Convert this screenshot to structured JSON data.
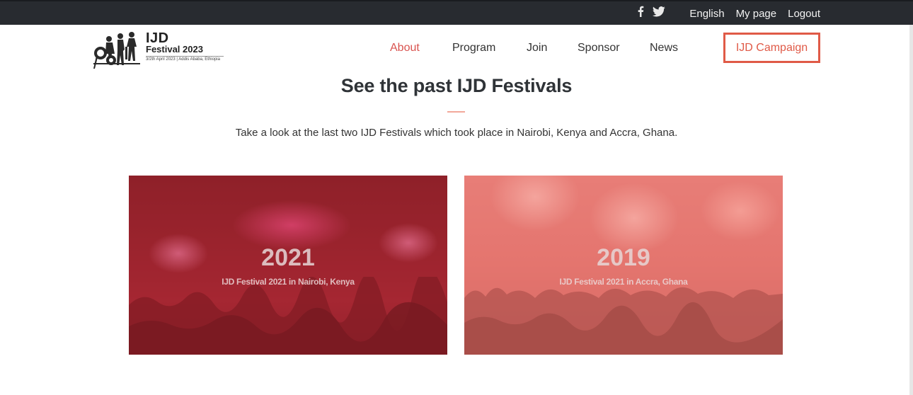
{
  "topbar": {
    "social": [
      {
        "icon": "facebook-icon",
        "glyph": "f"
      },
      {
        "icon": "twitter-icon"
      }
    ],
    "links": [
      "English",
      "My page",
      "Logout"
    ]
  },
  "logo": {
    "title": "IJD",
    "subtitle": "Festival 2023",
    "small": "3/2th April 2023 | Addis Ababa, Ethiopia"
  },
  "nav": {
    "items": [
      "About",
      "Program",
      "Join",
      "Sponsor",
      "News"
    ],
    "active": "About",
    "campaign": "IJD Campaign"
  },
  "section": {
    "title": "See the past IJD Festivals",
    "lead": "Take a look at the last two IJD Festivals which took place in Nairobi, Kenya and Accra, Ghana."
  },
  "cards": [
    {
      "year": "2021",
      "caption": "IJD Festival 2021 in Nairobi, Kenya"
    },
    {
      "year": "2019",
      "caption": "IJD Festival 2021 in Accra, Ghana"
    }
  ],
  "colors": {
    "accent": "#e05a47",
    "topbar": "#282b30",
    "active_nav": "#d9534f"
  }
}
